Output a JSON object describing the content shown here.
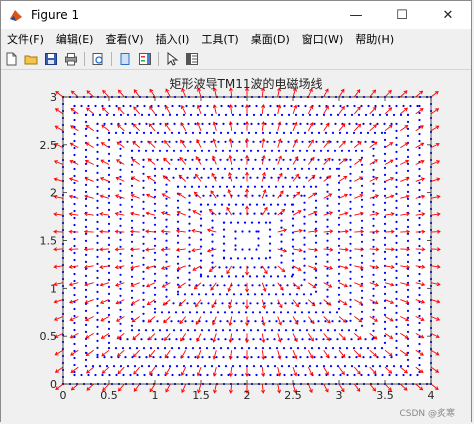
{
  "window": {
    "title": "Figure 1",
    "controls": {
      "minimize": "—",
      "maximize": "☐",
      "close": "✕"
    }
  },
  "menubar": {
    "items": [
      "文件(F)",
      "编辑(E)",
      "查看(V)",
      "插入(I)",
      "工具(T)",
      "桌面(D)",
      "窗口(W)",
      "帮助(H)"
    ]
  },
  "toolbar": {
    "icons": [
      "new-figure-icon",
      "open-file-icon",
      "save-icon",
      "print-icon",
      "print-preview-icon",
      "link-plot-icon",
      "insert-colorbar-icon",
      "insert-legend-icon",
      "pointer-icon",
      "property-inspector-icon"
    ]
  },
  "plot": {
    "title": "矩形波导TM11波的电磁场线",
    "watermark": "CSDN @炙寒"
  },
  "chart_data": {
    "type": "scatter",
    "title": "矩形波导TM11波的电磁场线",
    "xlabel": "",
    "ylabel": "",
    "xlim": [
      0,
      4
    ],
    "ylim": [
      0,
      3
    ],
    "xticks": [
      "0",
      "0.5",
      "1",
      "1.5",
      "2",
      "2.5",
      "3",
      "3.5",
      "4"
    ],
    "yticks": [
      "0",
      "0.5",
      "1",
      "1.5",
      "2",
      "2.5",
      "3"
    ],
    "grid": false,
    "series": [
      {
        "color": "#0000ff",
        "marker": "dot",
        "description_of_content": "magnetic field lines (dotted, blue) forming closed loops around center (2,1.5)"
      },
      {
        "color": "#ff0000",
        "marker": "arrow",
        "description_of_content": "electric field quiver arrows (red) radiating from center"
      }
    ],
    "center": [
      2,
      1.5
    ]
  },
  "colors": {
    "h_field": "#0000ff",
    "e_field": "#ff0000"
  }
}
